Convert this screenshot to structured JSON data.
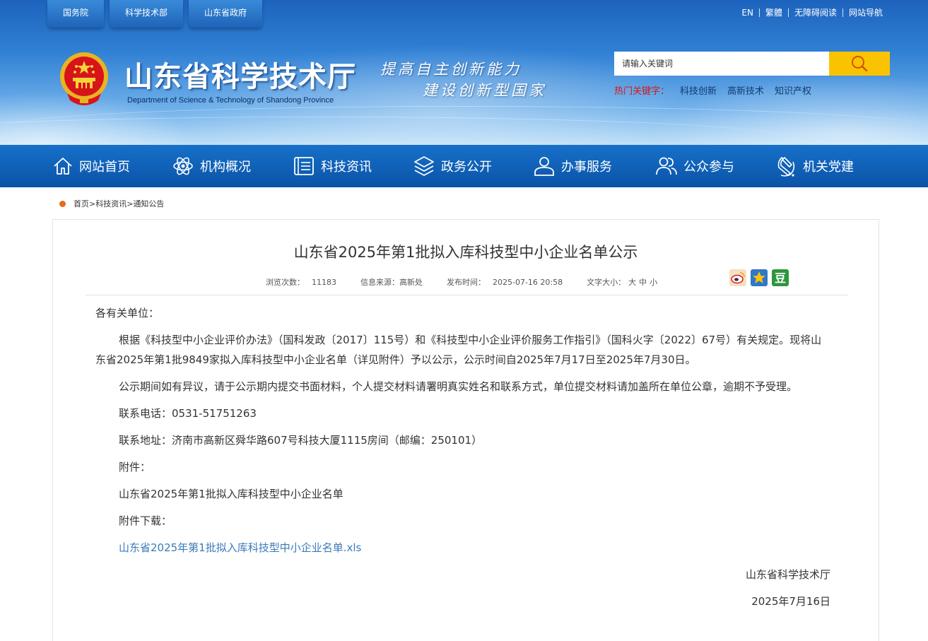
{
  "header": {
    "top_tabs": [
      "国务院",
      "科学技术部",
      "山东省政府"
    ],
    "top_links": [
      "EN",
      "繁體",
      "无障碍阅读",
      "网站导航"
    ],
    "site_title": "山东省科学技术厅",
    "site_subtitle": "Department of Science & Technology of Shandong Province",
    "slogan_line1": "提高自主创新能力",
    "slogan_line2": "建设创新型国家",
    "search_placeholder": "请输入关键词",
    "hot_label": "热门关键字：",
    "hot_words": [
      "科技创新",
      "高新技术",
      "知识产权"
    ]
  },
  "nav": [
    {
      "label": "网站首页",
      "icon": "home-icon"
    },
    {
      "label": "机构概况",
      "icon": "atom-icon"
    },
    {
      "label": "科技资讯",
      "icon": "news-list-icon"
    },
    {
      "label": "政务公开",
      "icon": "layers-icon"
    },
    {
      "label": "办事服务",
      "icon": "person-icon"
    },
    {
      "label": "公众参与",
      "icon": "people-icon"
    },
    {
      "label": "机关党建",
      "icon": "party-emblem-icon"
    }
  ],
  "breadcrumb": {
    "home": "首页",
    "sep": ">",
    "level1": "科技资讯",
    "level2": "通知公告"
  },
  "article": {
    "title": "山东省2025年第1批拟入库科技型中小企业名单公示",
    "views_label": "浏览次数：",
    "views": "11183",
    "source_label": "信息来源：",
    "source": "高新处",
    "date_label": "发布时间：",
    "date": "2025-07-16 20:58",
    "fontsize_label": "文字大小：",
    "fontsize_large": "大",
    "fontsize_medium": "中",
    "fontsize_small": "小",
    "share_icons": [
      "weibo-share-icon",
      "qzone-share-icon",
      "douban-share-icon"
    ],
    "salutation": "各有关单位：",
    "para1": "根据《科技型中小企业评价办法》（国科发政〔2017〕115号）和《科技型中小企业评价服务工作指引》（国科火字〔2022〕67号）有关规定。现将山东省2025年第1批9849家拟入库科技型中小企业名单（详见附件）予以公示，公示时间自2025年7月17日至2025年7月30日。",
    "para2": "公示期间如有异议，请于公示期内提交书面材料，个人提交材料请署明真实姓名和联系方式，单位提交材料请加盖所在单位公章，逾期不予受理。",
    "phone": "联系电话：0531-51751263",
    "address": "联系地址：济南市高新区舜华路607号科技大厦1115房间（邮编：250101）",
    "attachment_label": "附件：",
    "attachment_name": "山东省2025年第1批拟入库科技型中小企业名单",
    "download_label": "附件下载：",
    "download_link": "山东省2025年第1批拟入库科技型中小企业名单.xls",
    "signer": "山东省科学技术厅",
    "sign_date": "2025年7月16日"
  },
  "colors": {
    "nav_blue": "#0b54a8",
    "search_button": "#f9c301",
    "hot_label": "#d8141b",
    "breadcrumb_dot": "#e86a16",
    "link": "#3a7ab8"
  }
}
